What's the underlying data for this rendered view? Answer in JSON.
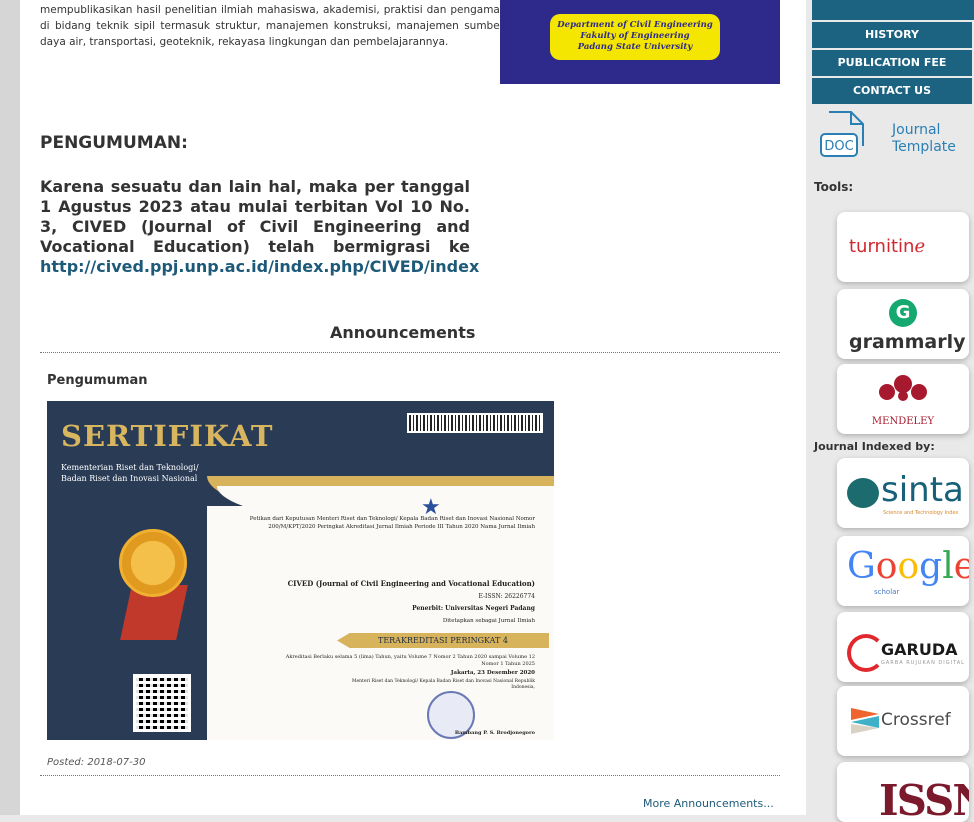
{
  "main": {
    "intro_text": "mempublikasikan hasil penelitian ilmiah mahasiswa, akademisi, praktisi dan pengamat di bidang teknik sipil termasuk struktur, manajemen konstruksi, manajemen sumber daya air, transportasi, geoteknik, rekayasa lingkungan dan pembelajarannya.",
    "banner": {
      "line1": "Department of Civil Engineering",
      "line2": "Fakulty of Engineering",
      "line3": "Padang State University"
    },
    "pengumuman_heading": "PENGUMUMAN:",
    "notice_text": "Karena sesuatu dan lain hal, maka per tanggal 1 Agustus 2023 atau mulai terbitan Vol 10 No. 3, CIVED (Journal of Civil Engineering and Vocational Education) telah bermigrasi ke",
    "notice_link": "http://cived.ppj.unp.ac.id/index.php/CIVED/index",
    "announcements_heading": "Announcements",
    "announcement": {
      "title": "Pengumuman",
      "posted": "Posted: 2018-07-30"
    },
    "more_link": "More Announcements..."
  },
  "certificate": {
    "title": "SERTIFIKAT",
    "subtitle1": "Kementerian Riset dan Teknologi/",
    "subtitle2": "Badan Riset dan Inovasi Nasional",
    "decree": "Petikan dari Keputusan Menteri Riset dan Teknologi/ Kepala Badan Riset dan Inovasi Nasional Nomor 200/M/KPT/2020 Peringkat Akreditasi Jurnal Ilmiah Periode III Tahun 2020 Nama Jurnal Ilmiah",
    "journal": "CIVED (Journal of Civil Engineering and Vocational Education)",
    "issn": "E-ISSN: 26226774",
    "publisher": "Penerbit: Universitas Negeri Padang",
    "ditetapkan": "Ditetapkan sebagai Jurnal Ilmiah",
    "rank": "TERAKREDITASI PERINGKAT 4",
    "akreditasi": "Akreditasi Berlaku selama 5 (lima) Tahun, yaitu Volume 7 Nomor 2 Tahun 2020 sampai Volume 12 Nomor 1 Tahun 2025",
    "date": "Jakarta, 23 Desember 2020",
    "signatory": "Menteri Riset dan Teknologi/ Kepala Badan Riset dan Inovasi Nasional Republik Indonesia,",
    "name": "Bambang P. S. Brodjonegoro"
  },
  "sidebar": {
    "nav": [
      "HISTORY",
      "PUBLICATION FEE",
      "CONTACT US"
    ],
    "doc_label": "DOC",
    "journal_template_1": "Journal",
    "journal_template_2": "Template",
    "tools_label": "Tools:",
    "turnitin": "turnitin",
    "grammarly_g": "G",
    "grammarly": "grammarly",
    "mendeley": "MENDELEY",
    "indexed_label": "Journal Indexed by:",
    "sinta": "sinta",
    "sinta_sub": "Science and Technology Index",
    "google": "Google",
    "scholar": "scholar",
    "garuda": "GARUDA",
    "garuda_sub": "GARBA RUJUKAN DIGITAL",
    "crossref": "Crossref",
    "issn": "ISSN"
  },
  "colors": {
    "nav_bg": "#1c6281",
    "link": "#1d5a7a",
    "cert_navy": "#2a3b55",
    "cert_gold": "#d7b35b"
  }
}
